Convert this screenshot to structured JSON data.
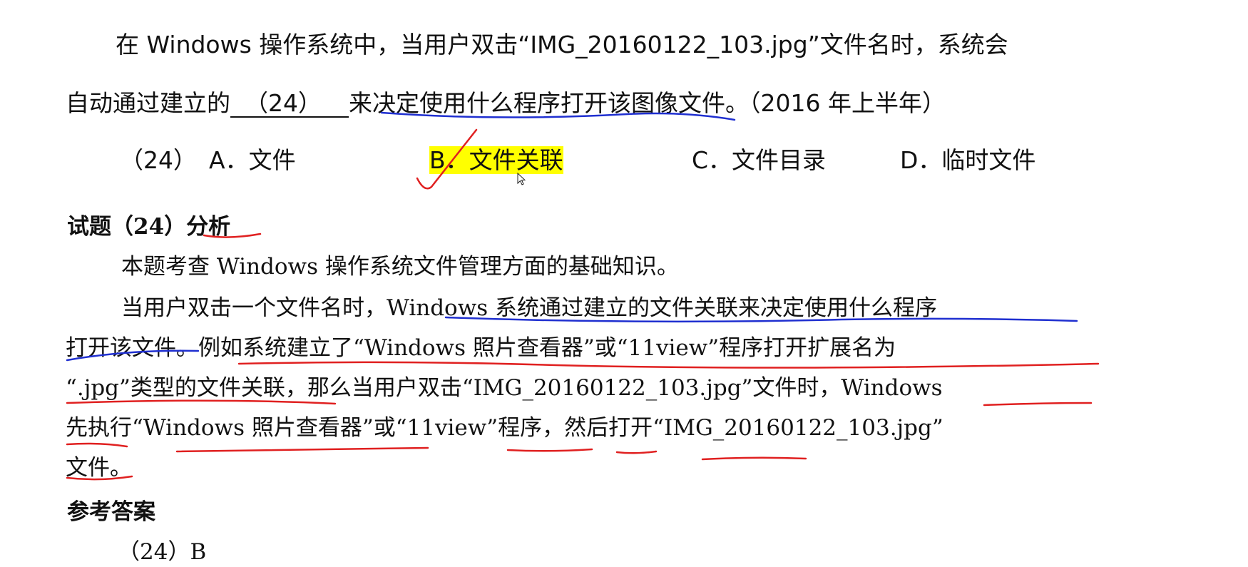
{
  "question": {
    "line1": "在 Windows 操作系统中，当用户双击“IMG_20160122_103.jpg”文件名时，系统会",
    "line2_pre": "自动通过建立的",
    "blank": "（24）",
    "line2_post": "来决定使用什么程序打开该图像文件。（2016 年上半年）"
  },
  "options": {
    "number": "（24）",
    "a": "A．文件",
    "b": "B．文件关联",
    "c": "C．文件目录",
    "d": "D．临时文件"
  },
  "analysis": {
    "heading": "试题（24）分析",
    "p1": "本题考查 Windows 操作系统文件管理方面的基础知识。",
    "p2_l1": "当用户双击一个文件名时，Windows 系统通过建立的文件关联来决定使用什么程序",
    "p2_l2": "打开该文件。例如系统建立了“Windows 照片查看器”或“11view”程序打开扩展名为",
    "p2_l3": "“.jpg”类型的文件关联，那么当用户双击“IMG_20160122_103.jpg”文件时，Windows",
    "p2_l4": "先执行“Windows 照片查看器”或“11view”程序，然后打开“IMG_20160122_103.jpg”",
    "p2_l5": "文件。"
  },
  "answer": {
    "heading": "参考答案",
    "value": "（24）B"
  },
  "colors": {
    "blue_ink": "#1f2fd0",
    "red_ink": "#e02020",
    "highlight": "#ffff00"
  }
}
